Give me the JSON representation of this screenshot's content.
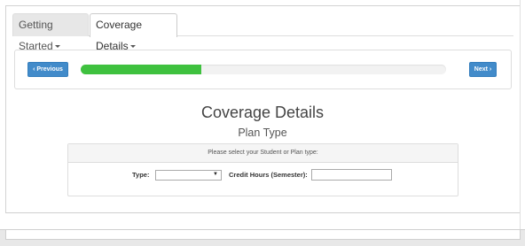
{
  "tabs": [
    {
      "label": "Getting Started",
      "active": false
    },
    {
      "label": "Coverage Details",
      "active": true
    }
  ],
  "wizard": {
    "previous_label": "‹ Previous",
    "next_label": "Next ›",
    "progress_percent": 33
  },
  "page": {
    "title": "Coverage Details",
    "section_title": "Plan Type"
  },
  "form": {
    "instruction": "Please select your Student or Plan type:",
    "type_label": "Type:",
    "type_selected": "",
    "credit_hours_label": "Credit Hours (Semester):",
    "credit_hours_value": ""
  },
  "colors": {
    "primary_button": "#428bca",
    "progress_fill": "#3fc13f"
  }
}
